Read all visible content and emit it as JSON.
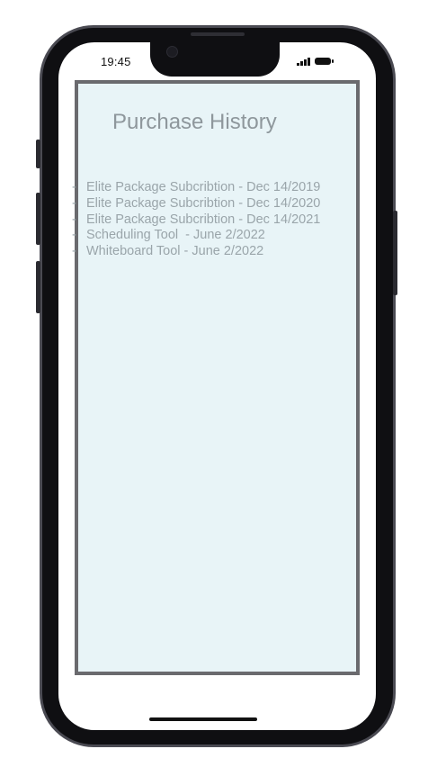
{
  "status_bar": {
    "time": "19:45",
    "signal_icon": "cellular-signal-icon",
    "battery_icon": "battery-icon"
  },
  "page": {
    "title": "Purchase History"
  },
  "purchase_history": {
    "bullet": "-",
    "items": [
      "Elite Package Subcribtion - Dec 14/2019",
      "Elite Package Subcribtion - Dec 14/2020",
      "Elite Package Subcribtion - Dec 14/2021",
      "Scheduling Tool  - June 2/2022",
      "Whiteboard Tool - June 2/2022"
    ]
  },
  "colors": {
    "screen_background": "#e8f4f7",
    "frame": "#0f0f12",
    "content_border": "#6a6a6e",
    "title_text": "#8e979c",
    "item_text": "#9aa5aa"
  }
}
